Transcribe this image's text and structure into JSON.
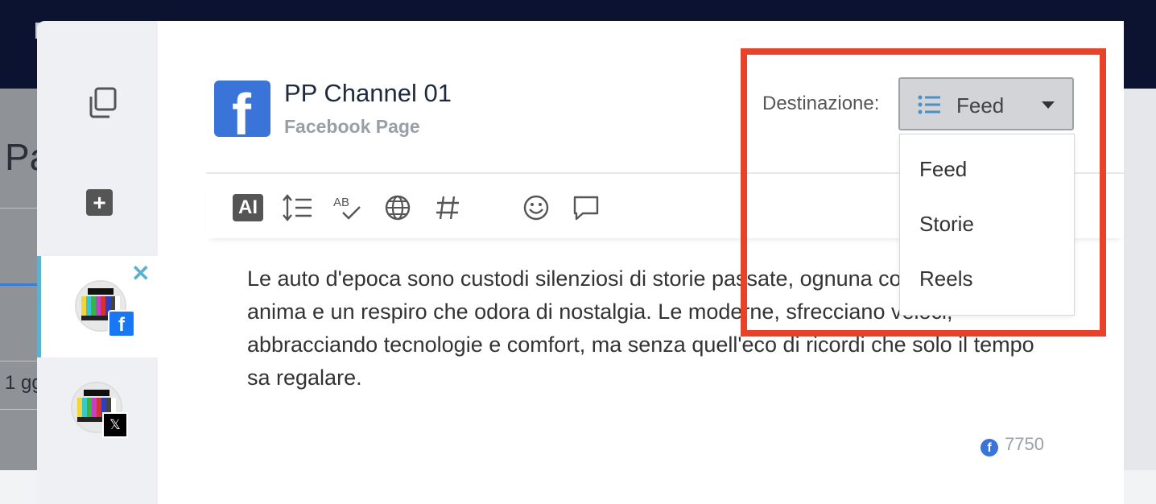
{
  "background": {
    "title_fragment": "Pa",
    "text_fragment": "1 gg"
  },
  "account": {
    "name": "PP Channel 01",
    "type": "Facebook Page"
  },
  "toolbar": {
    "ai_label": "AI",
    "icons": [
      "line-spacing-icon",
      "spellcheck-icon",
      "globe-icon",
      "hashtag-icon",
      "emoji-icon",
      "comment-icon"
    ]
  },
  "destination": {
    "label": "Destinazione:",
    "selected": "Feed",
    "options": [
      "Feed",
      "Storie",
      "Reels"
    ]
  },
  "post": {
    "text": "Le auto d'epoca sono custodi silenziosi di storie passate, ognuna con la propria anima e un respiro che odora di nostalgia. Le moderne, sfrecciano veloci, abbracciando tecnologie e comfort, ma senza quell'eco di ricordi che solo il tempo sa regalare."
  },
  "counter": {
    "value": "7750"
  },
  "colors": {
    "highlight": "#e8432a",
    "facebook": "#3b74d9",
    "active_accent": "#5fb0ce"
  }
}
